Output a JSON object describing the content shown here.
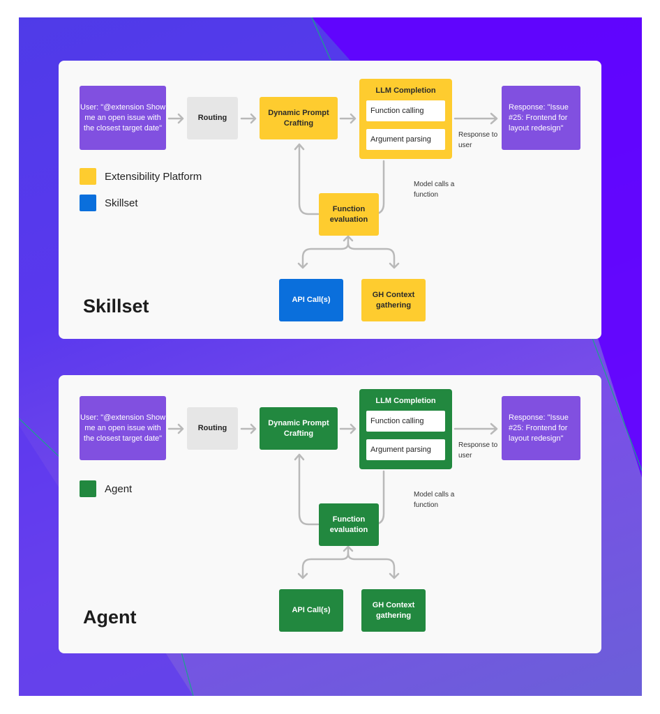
{
  "colors": {
    "user_box": "#8150e0",
    "routing": "#e6e6e6",
    "extensibility_platform": "#fecc2f",
    "skillset": "#0a6fdc",
    "agent": "#22883f",
    "arrow": "#b9b9b9"
  },
  "diagrams": [
    {
      "heading": "Skillset",
      "user_query": "User: \"@extension Show me an open issue with the closest target date\"",
      "routing": "Routing",
      "prompt_crafting": "Dynamic Prompt Crafting",
      "llm": {
        "title": "LLM Completion",
        "items": [
          "Function calling",
          "Argument parsing"
        ]
      },
      "response_label": "Response to user",
      "response": "Response: \"Issue #25: Frontend for layout redesign\"",
      "model_calls_label": "Model calls a function",
      "function_eval": "Function evaluation",
      "api_calls": "API Call(s)",
      "gh_context": "GH Context gathering",
      "legend": [
        {
          "label": "Extensibility Platform",
          "color": "#fecc2f"
        },
        {
          "label": "Skillset",
          "color": "#0a6fdc"
        }
      ]
    },
    {
      "heading": "Agent",
      "user_query": "User: \"@extension Show me an open issue with the closest target date\"",
      "routing": "Routing",
      "prompt_crafting": "Dynamic Prompt Crafting",
      "llm": {
        "title": "LLM Completion",
        "items": [
          "Function calling",
          "Argument parsing"
        ]
      },
      "response_label": "Response to user",
      "response": "Response: \"Issue #25: Frontend for layout redesign\"",
      "model_calls_label": "Model calls a function",
      "function_eval": "Function evaluation",
      "api_calls": "API Call(s)",
      "gh_context": "GH Context gathering",
      "legend": [
        {
          "label": "Agent",
          "color": "#22883f"
        }
      ]
    }
  ]
}
